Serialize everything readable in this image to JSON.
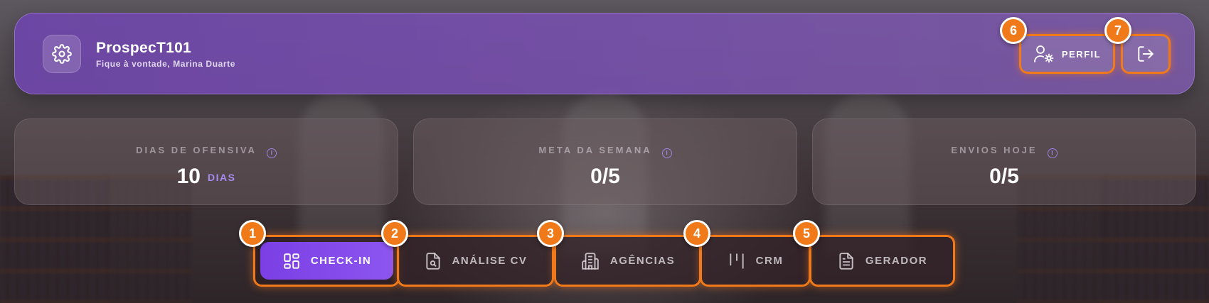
{
  "header": {
    "title": "ProspecT101",
    "subtitle": "Fique à vontade, Marina Duarte",
    "logo_icon": "gear-icon",
    "profile_label": "PERFIL",
    "profile_icon": "user-settings-icon",
    "logout_icon": "logout-icon"
  },
  "stats": [
    {
      "label": "DIAS DE OFENSIVA",
      "value": "10",
      "unit": "DIAS"
    },
    {
      "label": "META DA SEMANA",
      "value": "0/5"
    },
    {
      "label": "ENVIOS HOJE",
      "value": "0/5"
    }
  ],
  "tabs": [
    {
      "label": "CHECK-IN",
      "icon": "dashboard-grid-icon",
      "active": true
    },
    {
      "label": "ANÁLISE CV",
      "icon": "file-search-icon"
    },
    {
      "label": "AGÊNCIAS",
      "icon": "building-icon"
    },
    {
      "label": "CRM",
      "icon": "kanban-columns-icon"
    },
    {
      "label": "GERADOR",
      "icon": "document-text-icon"
    }
  ],
  "badges": [
    "1",
    "2",
    "3",
    "4",
    "5",
    "6",
    "7"
  ],
  "colors": {
    "accent": "#f07a1a",
    "primary": "#7b3fe4",
    "header_bg": "#6e46aa",
    "unit_text": "#a58cf0"
  }
}
